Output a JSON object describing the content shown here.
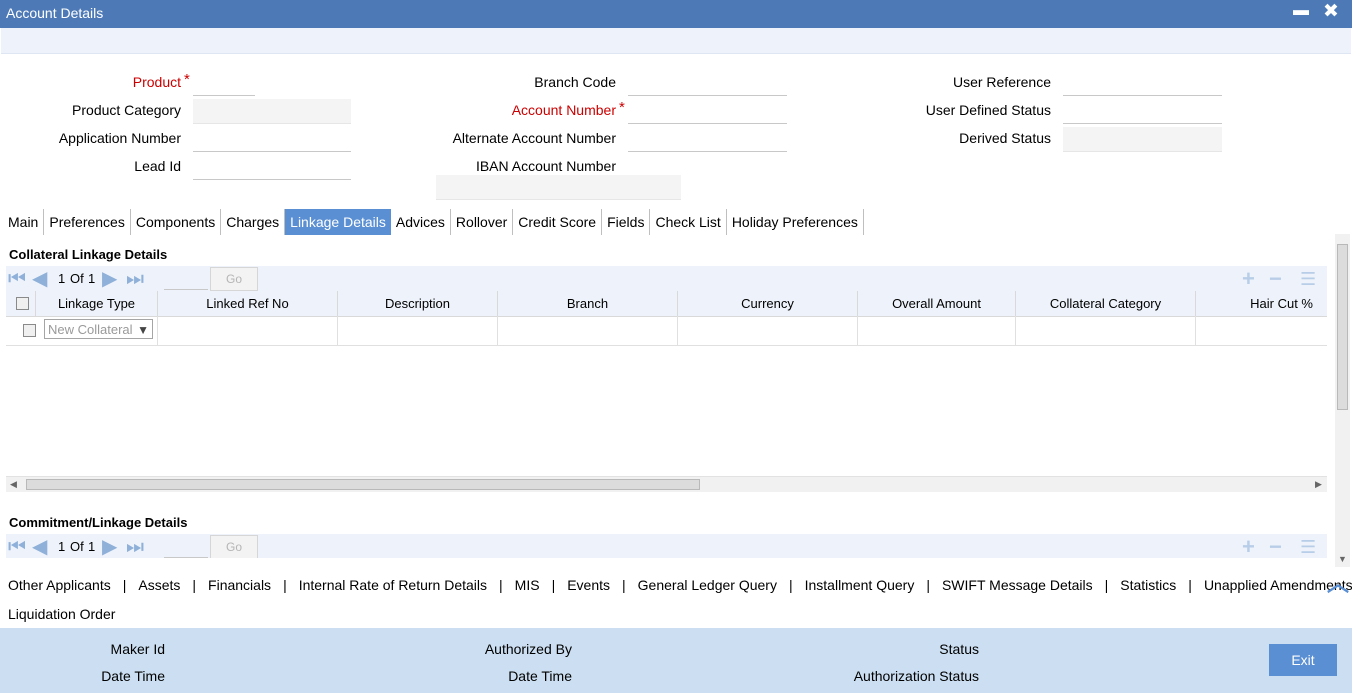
{
  "window": {
    "title": "Account Details",
    "minimize": "▬",
    "close": "✖"
  },
  "header": {
    "product_label": "Product",
    "product_category_label": "Product Category",
    "application_number_label": "Application Number",
    "lead_id_label": "Lead Id",
    "branch_code_label": "Branch Code",
    "account_number_label": "Account Number",
    "alternate_account_number_label": "Alternate Account Number",
    "iban_label": "IBAN Account Number",
    "user_reference_label": "User Reference",
    "user_defined_status_label": "User Defined Status",
    "derived_status_label": "Derived Status",
    "required_mark": "*"
  },
  "tabs": [
    "Main",
    "Preferences",
    "Components",
    "Charges",
    "Linkage Details",
    "Advices",
    "Rollover",
    "Credit Score",
    "Fields",
    "Check List",
    "Holiday Preferences"
  ],
  "active_tab": "Linkage Details",
  "collateral": {
    "title": "Collateral Linkage Details",
    "page_current": "1",
    "page_of": "Of",
    "page_total": "1",
    "go": "Go",
    "columns": [
      "Linkage Type",
      "Linked Ref No",
      "Description",
      "Branch",
      "Currency",
      "Overall Amount",
      "Collateral Category",
      "Hair Cut %"
    ],
    "row_linkage_type": "New Collateral"
  },
  "commitment": {
    "title": "Commitment/Linkage Details",
    "page_current": "1",
    "page_of": "Of",
    "page_total": "1",
    "go": "Go"
  },
  "bottom_links": [
    "Other Applicants",
    "Assets",
    "Financials",
    "Internal Rate of Return Details",
    "MIS",
    "Events",
    "General Ledger Query",
    "Installment Query",
    "SWIFT Message Details",
    "Statistics",
    "Unapplied Amendments",
    "Liquidation Order"
  ],
  "link_separator": "|",
  "footer": {
    "maker_id": "Maker Id",
    "date_time_1": "Date Time",
    "authorized_by": "Authorized By",
    "date_time_2": "Date Time",
    "status": "Status",
    "authorization_status": "Authorization Status",
    "exit": "Exit"
  },
  "colors": {
    "titlebar": "#4d7ab7",
    "active_tab": "#5a8fd3",
    "required": "#cc0000",
    "footer": "#ccdff2"
  }
}
